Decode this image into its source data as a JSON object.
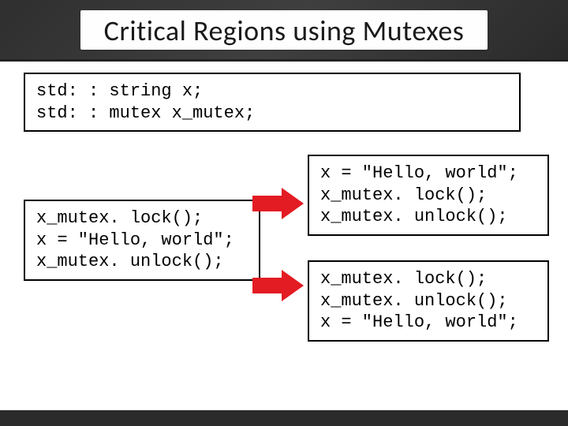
{
  "title": "Critical Regions using Mutexes",
  "declarations": "std: : string x;\nstd: : mutex x_mutex;",
  "left_code": "x_mutex. lock();\nx = \"Hello, world\";\nx_mutex. unlock();",
  "right_top_code": "x = \"Hello, world\";\nx_mutex. lock();\nx_mutex. unlock();",
  "right_bottom_code": "x_mutex. lock();\nx_mutex. unlock();\nx = \"Hello, world\";"
}
